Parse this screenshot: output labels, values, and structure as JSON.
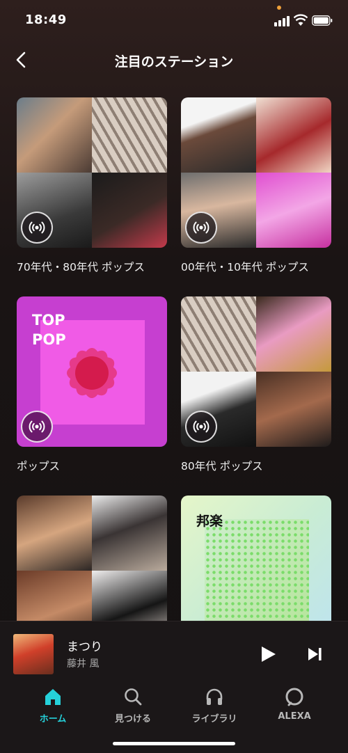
{
  "status": {
    "time": "18:49"
  },
  "header": {
    "title": "注目のステーション"
  },
  "stations": [
    {
      "label": "70年代・80年代 ポップス"
    },
    {
      "label": "00年代・10年代 ポップス"
    },
    {
      "label": "ポップス",
      "cover_text": [
        "TOP",
        "POP"
      ]
    },
    {
      "label": "80年代 ポップス"
    },
    {
      "label": ""
    },
    {
      "label": "",
      "cover_text": [
        "邦楽"
      ]
    }
  ],
  "now_playing": {
    "title": "まつり",
    "artist": "藤井 風"
  },
  "tabs": [
    {
      "label": "ホーム",
      "icon": "home-icon",
      "active": true
    },
    {
      "label": "見つける",
      "icon": "search-icon"
    },
    {
      "label": "ライブラリ",
      "icon": "headphones-icon"
    },
    {
      "label": "ALEXA",
      "icon": "alexa-icon"
    }
  ],
  "colors": {
    "accent": "#25d1da",
    "status_dot": "#f0a13a"
  }
}
